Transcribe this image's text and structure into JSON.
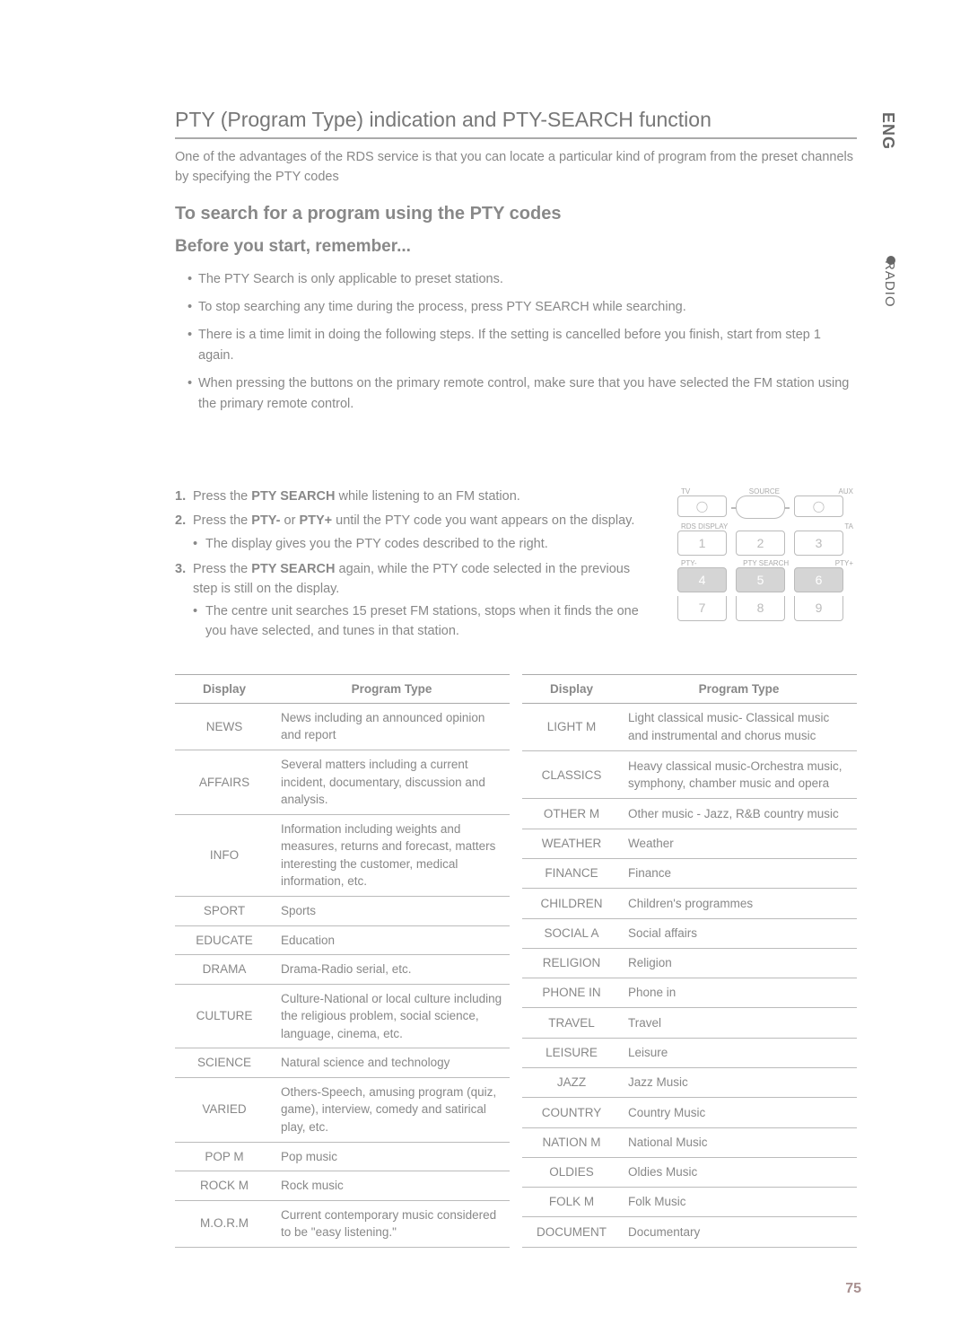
{
  "side": {
    "lang": "ENG",
    "section": "RADIO"
  },
  "title": "PTY (Program Type) indication and PTY-SEARCH function",
  "intro": "One  of the advantages of the RDS service is that you can locate a particular kind of program from the preset channels by specifying the PTY codes",
  "heading2": "To search for a program using the PTY codes",
  "heading3": "Before you start, remember...",
  "bullets": [
    "The PTY Search is only applicable to preset stations.",
    "To stop searching any time during the process, press PTY SEARCH while searching.",
    "There is a time limit in doing the following steps. If the setting is cancelled before you finish,  start from step 1 again.",
    "When pressing the buttons on the primary remote control, make sure that you have selected the FM station using the primary remote control."
  ],
  "steps": {
    "s1a": "Press the ",
    "s1b": "PTY SEARCH",
    "s1c": " while listening to an FM station.",
    "s2a": "Press the ",
    "s2b": "PTY-",
    "s2c": " or ",
    "s2d": "PTY+",
    "s2e": " until the PTY code you want appears on the display.",
    "s2sub": "The display gives you the PTY codes described to the right.",
    "s3a": "Press the ",
    "s3b": "PTY SEARCH",
    "s3c": " again, while the PTY code selected in the previous step is still on the display.",
    "s3sub": "The centre unit searches 15 preset FM stations, stops when it finds the one you have selected, and tunes in that station."
  },
  "remote": {
    "r1": [
      "TV",
      "SOURCE",
      "AUX"
    ],
    "r2l": "RDS DISPLAY",
    "r2r": "TA",
    "r2": [
      "1",
      "2",
      "3"
    ],
    "r3l": [
      "PTY-",
      "PTY SEARCH",
      "PTY+"
    ],
    "r3": [
      "4",
      "5",
      "6"
    ],
    "r4": [
      "7",
      "8",
      "9"
    ]
  },
  "tableHeaders": {
    "display": "Display",
    "type": "Program Type"
  },
  "tableLeft": [
    {
      "code": "NEWS",
      "desc": "News including an announced opinion and report"
    },
    {
      "code": "AFFAIRS",
      "desc": "Several matters including a current incident, documentary, discussion and analysis."
    },
    {
      "code": "INFO",
      "desc": "Information including weights and measures, returns and forecast, matters interesting the customer, medical information, etc."
    },
    {
      "code": "SPORT",
      "desc": "Sports"
    },
    {
      "code": "EDUCATE",
      "desc": "Education"
    },
    {
      "code": "DRAMA",
      "desc": "Drama-Radio serial, etc."
    },
    {
      "code": "CULTURE",
      "desc": "Culture-National or local culture including the religious problem, social science, language, cinema, etc."
    },
    {
      "code": "SCIENCE",
      "desc": "Natural science and technology"
    },
    {
      "code": "VARIED",
      "desc": "Others-Speech, amusing program (quiz, game), interview, comedy and satirical play, etc."
    },
    {
      "code": "POP M",
      "desc": "Pop music"
    },
    {
      "code": "ROCK M",
      "desc": "Rock music"
    },
    {
      "code": "M.O.R.M",
      "desc": "Current contemporary music considered to be \"easy listening.\""
    }
  ],
  "tableRight": [
    {
      "code": "LIGHT M",
      "desc": "Light classical music- Classical music and instrumental and chorus music"
    },
    {
      "code": "CLASSICS",
      "desc": "Heavy classical  music-Orchestra music, symphony, chamber music and opera"
    },
    {
      "code": "OTHER M",
      "desc": "Other music - Jazz, R&B country music"
    },
    {
      "code": "WEATHER",
      "desc": "Weather"
    },
    {
      "code": "FINANCE",
      "desc": "Finance"
    },
    {
      "code": "CHILDREN",
      "desc": "Children's programmes"
    },
    {
      "code": "SOCIAL A",
      "desc": "Social affairs"
    },
    {
      "code": "RELIGION",
      "desc": "Religion"
    },
    {
      "code": "PHONE IN",
      "desc": "Phone in"
    },
    {
      "code": "TRAVEL",
      "desc": "Travel"
    },
    {
      "code": "LEISURE",
      "desc": "Leisure"
    },
    {
      "code": "JAZZ",
      "desc": "Jazz Music"
    },
    {
      "code": "COUNTRY",
      "desc": "Country Music"
    },
    {
      "code": "NATION M",
      "desc": "National Music"
    },
    {
      "code": "OLDIES",
      "desc": "Oldies Music"
    },
    {
      "code": "FOLK M",
      "desc": "Folk Music"
    },
    {
      "code": "DOCUMENT",
      "desc": "Documentary"
    }
  ],
  "pageNumber": "75"
}
